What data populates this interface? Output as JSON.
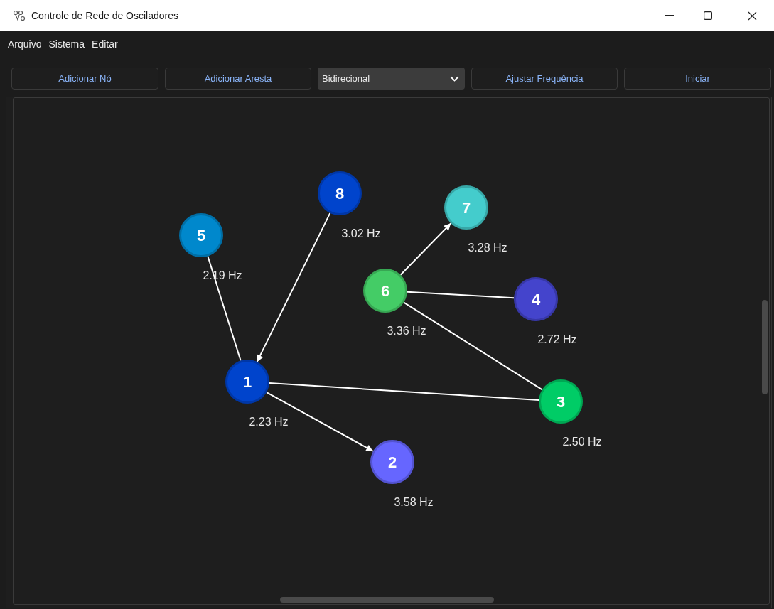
{
  "window": {
    "title": "Controle de Rede de Osciladores"
  },
  "menu": [
    "Arquivo",
    "Sistema",
    "Editar"
  ],
  "toolbar": [
    {
      "kind": "button",
      "label": "Adicionar Nó"
    },
    {
      "kind": "button",
      "label": "Adicionar Aresta"
    },
    {
      "kind": "dropdown",
      "label": "Bidirecional"
    },
    {
      "kind": "button",
      "label": "Ajustar Frequência"
    },
    {
      "kind": "button",
      "label": "Iniciar"
    }
  ],
  "nodes": [
    {
      "number": "1",
      "frequency": "2.23 Hz",
      "color": "#0044cc"
    },
    {
      "number": "2",
      "frequency": "3.58 Hz",
      "color": "#6666ff"
    },
    {
      "number": "3",
      "frequency": "2.50 Hz",
      "color": "#00cc66"
    },
    {
      "number": "4",
      "frequency": "2.72 Hz",
      "color": "#4444cc"
    },
    {
      "number": "5",
      "frequency": "2.19 Hz",
      "color": "#0088cc"
    },
    {
      "number": "6",
      "frequency": "3.36 Hz",
      "color": "#44cc66"
    },
    {
      "number": "7",
      "frequency": "3.28 Hz",
      "color": "#44cccc"
    },
    {
      "number": "8",
      "frequency": "3.02 Hz",
      "color": "#0044cc"
    }
  ],
  "edges": [
    {
      "directed": false
    },
    {
      "directed": true
    },
    {
      "directed": true
    },
    {
      "directed": false
    },
    {
      "directed": false
    },
    {
      "directed": false
    },
    {
      "directed": true
    }
  ]
}
